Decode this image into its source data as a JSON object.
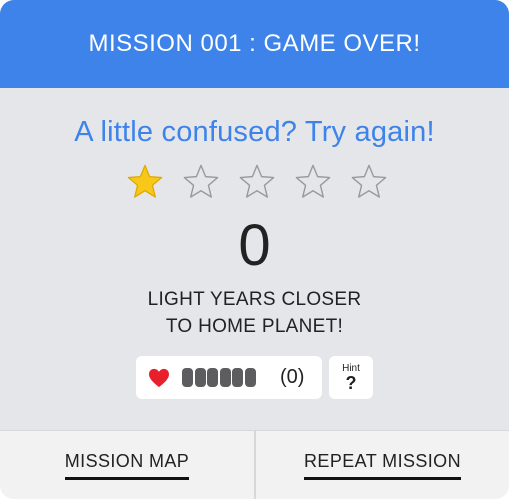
{
  "header": {
    "title": "MISSION 001 : GAME OVER!",
    "color": "#3d83ea"
  },
  "message": "A little confused? Try again!",
  "rating": {
    "filled": 1,
    "total": 5,
    "filled_color": "#f7c81a",
    "icon": "star-icon"
  },
  "score": {
    "value": "0",
    "caption_line1": "LIGHT YEARS CLOSER",
    "caption_line2": "TO HOME PLANET!"
  },
  "lives": {
    "icon": "heart-icon",
    "heart_color": "#e8202c",
    "pip_count": 6,
    "count_text": "(0)"
  },
  "hint": {
    "label": "Hint",
    "mark": "?"
  },
  "footer": {
    "left_label": "MISSION MAP",
    "right_label": "REPEAT MISSION"
  }
}
